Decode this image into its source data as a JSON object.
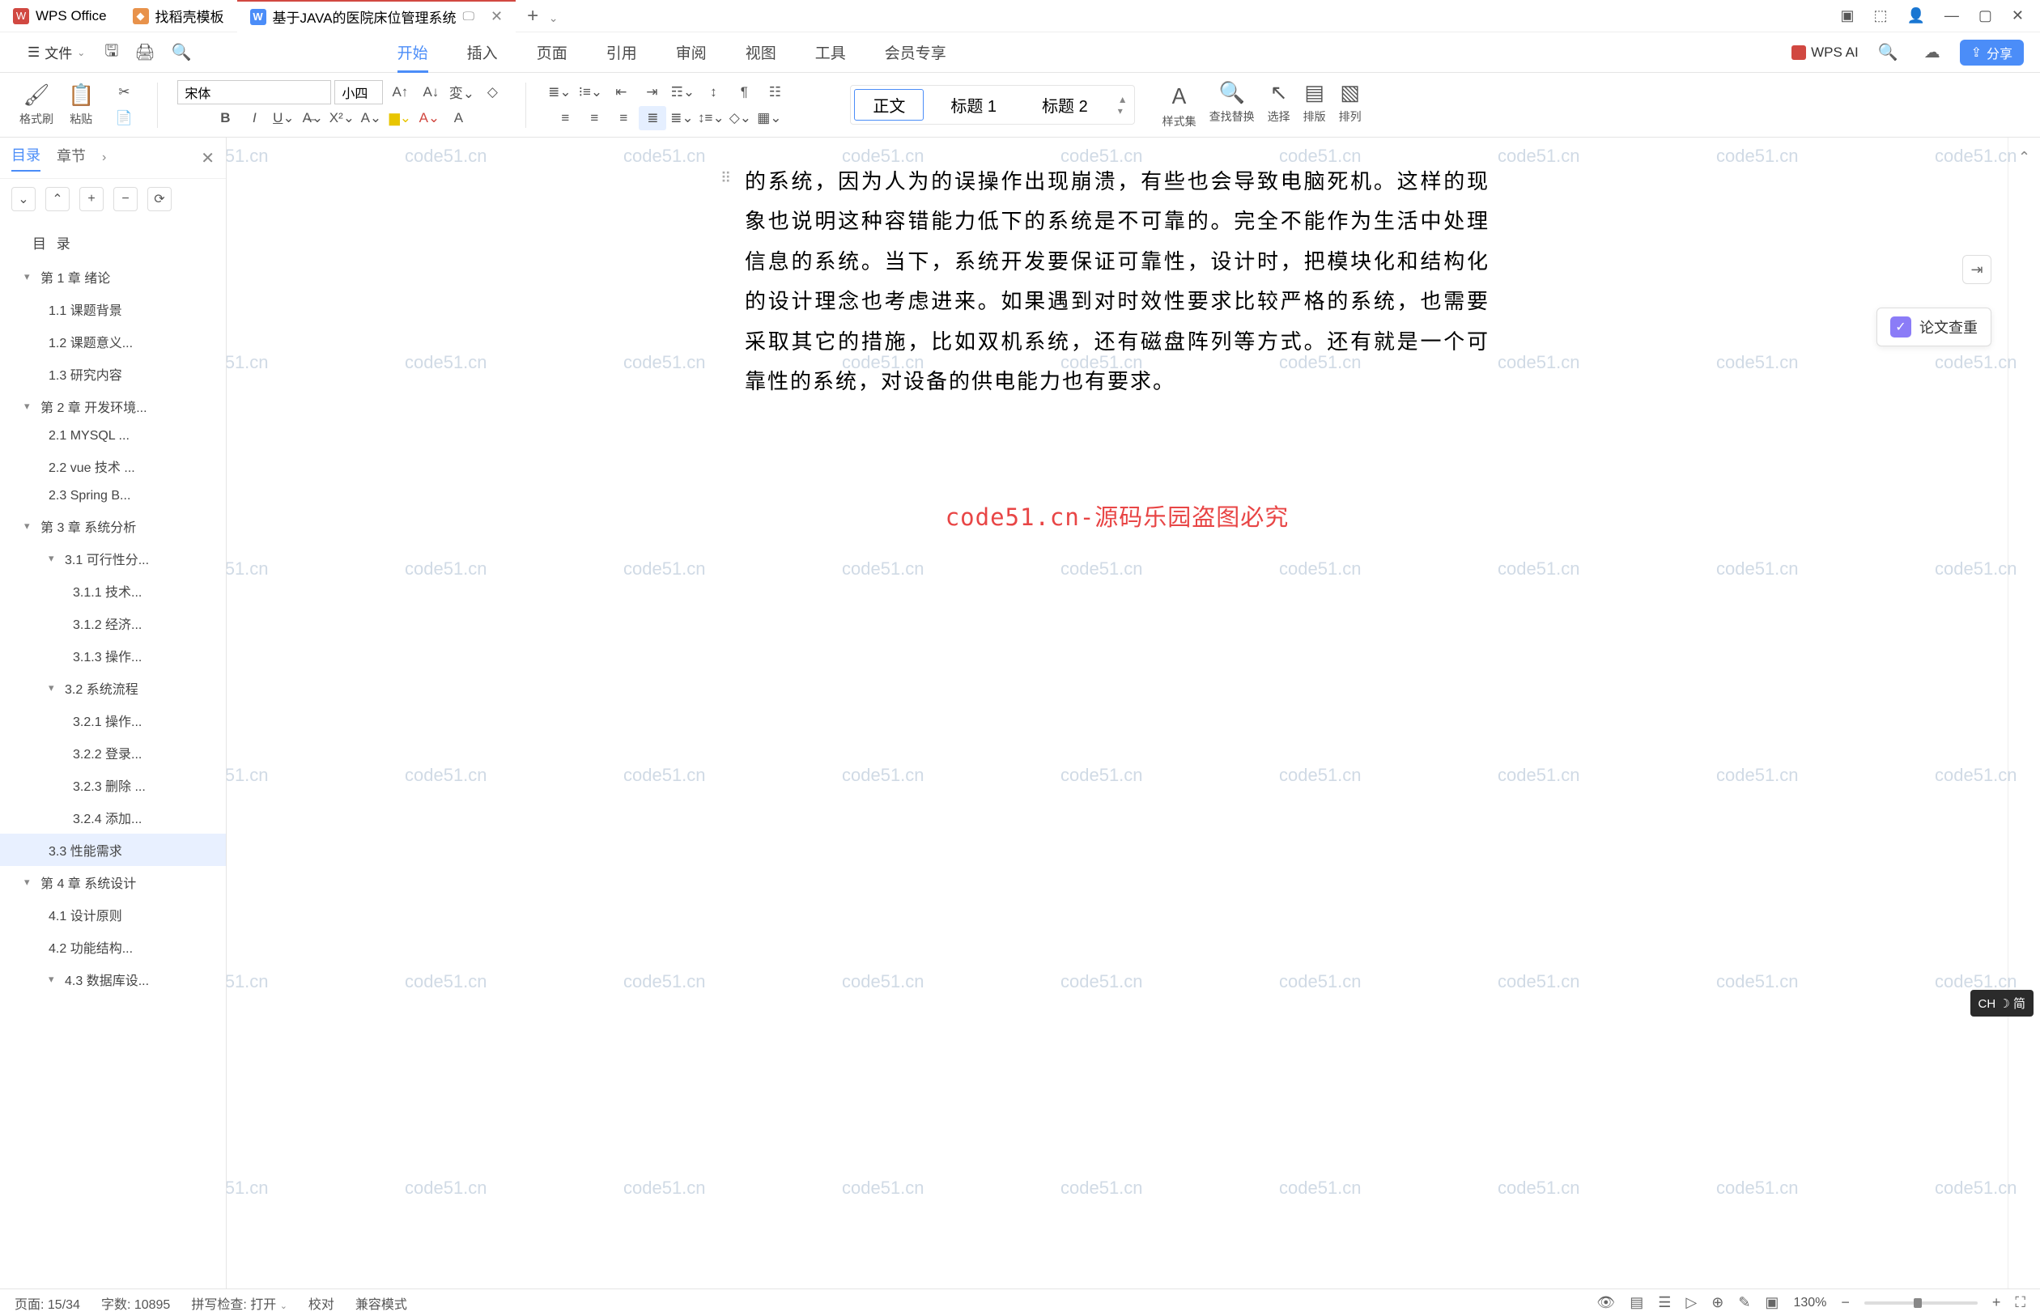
{
  "titlebar": {
    "tabs": [
      {
        "icon": "wps",
        "label": "WPS Office"
      },
      {
        "icon": "dk",
        "label": "找稻壳模板"
      },
      {
        "icon": "w",
        "label": "基于JAVA的医院床位管理系统",
        "monitor": true,
        "closable": true,
        "active": true
      }
    ],
    "plus": "+"
  },
  "menubar": {
    "file": "文件",
    "menus": [
      "开始",
      "插入",
      "页面",
      "引用",
      "审阅",
      "视图",
      "工具",
      "会员专享"
    ],
    "active_menu": "开始",
    "wps_ai": "WPS AI",
    "share": "分享"
  },
  "ribbon": {
    "format_painter": "格式刷",
    "paste": "粘贴",
    "font_name": "宋体",
    "font_size": "小四",
    "styles": [
      {
        "label": "正文",
        "selected": true
      },
      {
        "label": "标题 1",
        "selected": false
      },
      {
        "label": "标题 2",
        "selected": false
      }
    ],
    "style_set": "样式集",
    "find_replace": "查找替换",
    "select": "选择",
    "layout": "排版",
    "arrange": "排列"
  },
  "outline": {
    "tab_toc": "目录",
    "tab_chapter": "章节",
    "header": "目  录",
    "items": [
      {
        "level": 1,
        "caret": true,
        "label": "第 1 章  绪论"
      },
      {
        "level": 2,
        "label": "1.1  课题背景"
      },
      {
        "level": 2,
        "label": "1.2  课题意义..."
      },
      {
        "level": 2,
        "label": "1.3  研究内容"
      },
      {
        "level": 1,
        "caret": true,
        "label": "第 2 章  开发环境..."
      },
      {
        "level": 2,
        "label": "2.1 MYSQL ..."
      },
      {
        "level": 2,
        "label": "2.2 vue 技术 ..."
      },
      {
        "level": 2,
        "label": "2.3 Spring B..."
      },
      {
        "level": 1,
        "caret": true,
        "label": "第 3 章  系统分析"
      },
      {
        "level": 2,
        "caret": true,
        "label": "3.1  可行性分..."
      },
      {
        "level": 3,
        "label": "3.1.1  技术..."
      },
      {
        "level": 3,
        "label": "3.1.2  经济..."
      },
      {
        "level": 3,
        "label": "3.1.3  操作..."
      },
      {
        "level": 2,
        "caret": true,
        "label": "3.2  系统流程"
      },
      {
        "level": 3,
        "label": "3.2.1  操作..."
      },
      {
        "level": 3,
        "label": "3.2.2  登录..."
      },
      {
        "level": 3,
        "label": "3.2.3  删除 ..."
      },
      {
        "level": 3,
        "label": "3.2.4  添加..."
      },
      {
        "level": 2,
        "label": "3.3  性能需求",
        "active": true
      },
      {
        "level": 1,
        "caret": true,
        "label": "第 4 章  系统设计"
      },
      {
        "level": 2,
        "label": "4.1  设计原则"
      },
      {
        "level": 2,
        "label": "4.2  功能结构..."
      },
      {
        "level": 2,
        "caret": true,
        "label": "4.3  数据库设..."
      }
    ]
  },
  "document": {
    "paragraph": "的系统，因为人为的误操作出现崩溃，有些也会导致电脑死机。这样的现象也说明这种容错能力低下的系统是不可靠的。完全不能作为生活中处理信息的系统。当下，系统开发要保证可靠性，设计时，把模块化和结构化的设计理念也考虑进来。如果遇到对时效性要求比较严格的系统，也需要采取其它的措施，比如双机系统，还有磁盘阵列等方式。还有就是一个可靠性的系统，对设备的供电能力也有要求。",
    "watermark_center": "code51.cn-源码乐园盗图必究"
  },
  "floating": {
    "paper_check": "论文查重",
    "ime": "CH ☽ 简"
  },
  "statusbar": {
    "page": "页面: 15/34",
    "words": "字数: 10895",
    "spell": "拼写检查: 打开",
    "proof": "校对",
    "compat": "兼容模式",
    "zoom": "130%"
  },
  "watermark_text": "code51.cn"
}
